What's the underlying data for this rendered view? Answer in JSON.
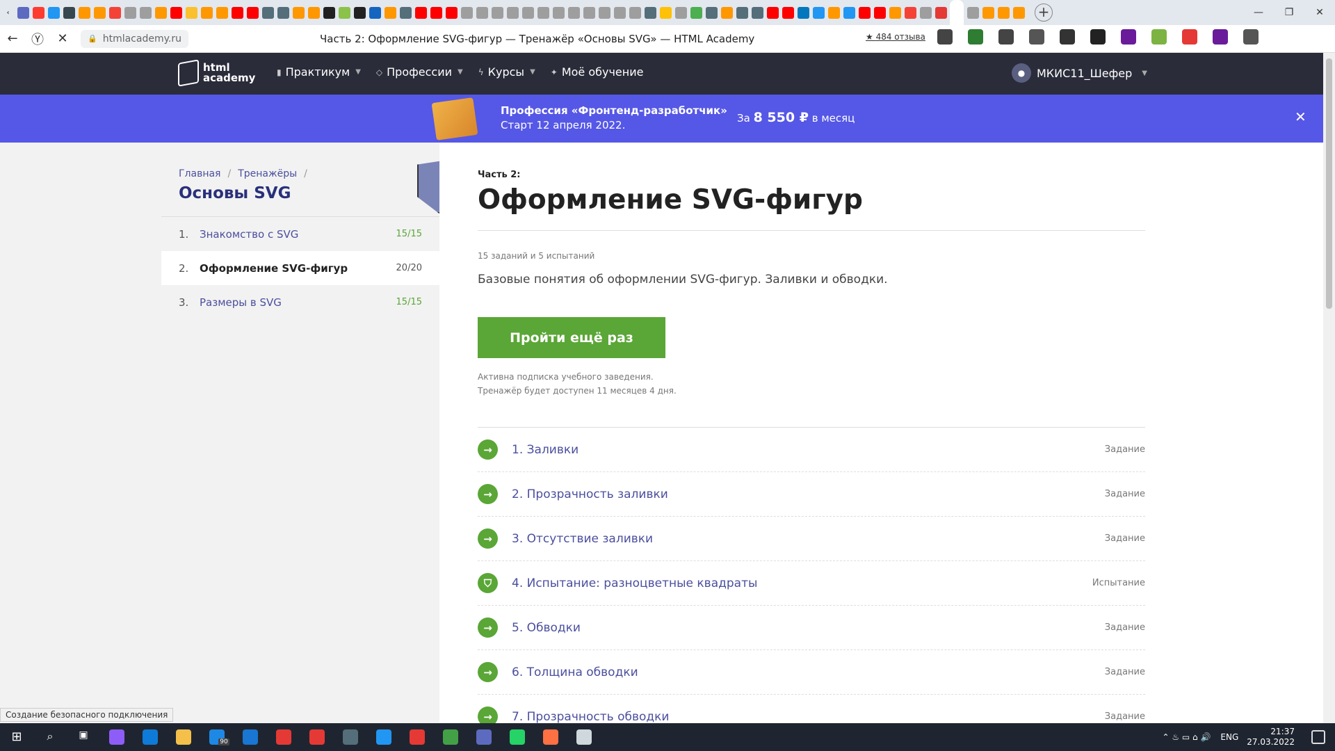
{
  "browser": {
    "tab_colors": [
      "#5c6bc0",
      "#ff3b30",
      "#2196f3",
      "#37474f",
      "#ff9800",
      "#ff9800",
      "#f44336",
      "#9e9e9e",
      "#9e9e9e",
      "#ff9800",
      "#ff0000",
      "#fbc02d",
      "#ff9800",
      "#ff9800",
      "#ff0000",
      "#ff0000",
      "#546e7a",
      "#546e7a",
      "#ff9800",
      "#ff9800",
      "#212121",
      "#8bc34a",
      "#212121",
      "#1565c0",
      "#ff9800",
      "#546e7a",
      "#ff0000",
      "#ff0000",
      "#ff0000",
      "#9e9e9e",
      "#9e9e9e",
      "#9e9e9e",
      "#9e9e9e",
      "#9e9e9e",
      "#9e9e9e",
      "#9e9e9e",
      "#9e9e9e",
      "#9e9e9e",
      "#9e9e9e",
      "#9e9e9e",
      "#9e9e9e",
      "#546e7a",
      "#ffc107",
      "#9e9e9e",
      "#4caf50",
      "#546e7a",
      "#ff9800",
      "#546e7a",
      "#546e7a",
      "#ff0000",
      "#ff0000",
      "#0277bd",
      "#2196f3",
      "#ff9800",
      "#2196f3",
      "#ff0000",
      "#ff0000",
      "#ff9800",
      "#f44336",
      "#9e9e9e",
      "#e53935",
      "#9e9e9e",
      "#ff9800",
      "#ff9800",
      "#ff9800"
    ],
    "url": "htmlacademy.ru",
    "page_title": "Часть 2: Оформление SVG-фигур — Тренажёр «Основы SVG» — HTML Academy",
    "reviews": "484 отзыва",
    "ext_colors": [
      "#444",
      "#2e7d32",
      "#444",
      "#555",
      "#333",
      "#222",
      "#6a1b9a",
      "#7cb342",
      "#e53935",
      "#6a1b9a",
      "#555"
    ],
    "status_tip": "Создание безопасного подключения"
  },
  "header": {
    "logo_line1": "html",
    "logo_line2": "academy",
    "menu": [
      {
        "label": "Практикум",
        "icon": "bar-chart-icon",
        "has_caret": true
      },
      {
        "label": "Профессии",
        "icon": "diamond-icon",
        "has_caret": true
      },
      {
        "label": "Курсы",
        "icon": "lightning-icon",
        "has_caret": true
      },
      {
        "label": "Моё обучение",
        "icon": "run-icon",
        "has_caret": false
      }
    ],
    "user_name": "МКИС11_Шефер"
  },
  "banner": {
    "title": "Профессия «Фронтенд-разработчик»",
    "subtitle": "Старт 12 апреля 2022.",
    "price_prefix": "За",
    "price": "8 550 ₽",
    "price_suffix": "в месяц"
  },
  "sidebar": {
    "breadcrumbs": [
      "Главная",
      "Тренажёры"
    ],
    "course_title": "Основы SVG",
    "chapters": [
      {
        "num": "1.",
        "label": "Знакомство с SVG",
        "progress": "15/15",
        "active": false
      },
      {
        "num": "2.",
        "label": "Оформление SVG-фигур",
        "progress": "20/20",
        "active": true
      },
      {
        "num": "3.",
        "label": "Размеры в SVG",
        "progress": "15/15",
        "active": false
      }
    ]
  },
  "main": {
    "part_label": "Часть 2:",
    "title": "Оформление SVG-фигур",
    "counts": "15 заданий и 5 испытаний",
    "description": "Базовые понятия об оформлении SVG-фигур. Заливки и обводки.",
    "retry_label": "Пройти ещё раз",
    "note_line1": "Активна подписка учебного заведения.",
    "note_line2": "Тренажёр будет доступен 11 месяцев 4 дня.",
    "lessons": [
      {
        "title": "1. Заливки",
        "type": "Задание",
        "icon": "arrow"
      },
      {
        "title": "2. Прозрачность заливки",
        "type": "Задание",
        "icon": "arrow"
      },
      {
        "title": "3. Отсутствие заливки",
        "type": "Задание",
        "icon": "arrow"
      },
      {
        "title": "4. Испытание: разноцветные квадраты",
        "type": "Испытание",
        "icon": "shield"
      },
      {
        "title": "5. Обводки",
        "type": "Задание",
        "icon": "arrow"
      },
      {
        "title": "6. Толщина обводки",
        "type": "Задание",
        "icon": "arrow"
      },
      {
        "title": "7. Прозрачность обводки",
        "type": "Задание",
        "icon": "arrow"
      }
    ]
  },
  "taskbar": {
    "app_colors": [
      "#8e5cf7",
      "#0f7bd8",
      "#f4c04a",
      "#1e88e5",
      "#1976d2",
      "#e53935",
      "#e53935",
      "#546e7a",
      "#2196f3",
      "#e53935",
      "#43a047",
      "#5c6bc0",
      "#25d366",
      "#ff7043",
      "#cfd8dc"
    ],
    "mail_badge": "90",
    "lang": "ENG",
    "time": "21:37",
    "date": "27.03.2022"
  }
}
